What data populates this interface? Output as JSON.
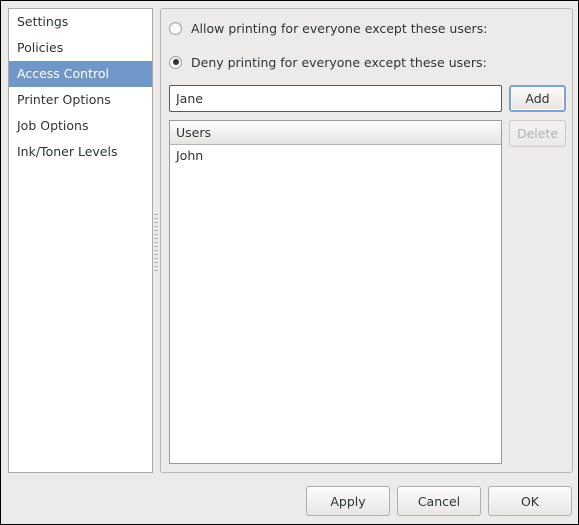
{
  "sidebar": {
    "items": [
      {
        "label": "Settings",
        "selected": false
      },
      {
        "label": "Policies",
        "selected": false
      },
      {
        "label": "Access Control",
        "selected": true
      },
      {
        "label": "Printer Options",
        "selected": false
      },
      {
        "label": "Job Options",
        "selected": false
      },
      {
        "label": "Ink/Toner Levels",
        "selected": false
      }
    ]
  },
  "access_control": {
    "allow_option_label": "Allow printing for everyone except these users:",
    "deny_option_label": "Deny printing for everyone except these users:",
    "allow_selected": false,
    "deny_selected": true,
    "user_entry": {
      "value": "Jane",
      "placeholder": ""
    },
    "add_label": "Add",
    "delete_label": "Delete",
    "delete_disabled": true,
    "list": {
      "header": "Users",
      "rows": [
        "John"
      ]
    }
  },
  "dialog_buttons": {
    "apply": "Apply",
    "cancel": "Cancel",
    "ok": "OK"
  },
  "colors": {
    "selection": "#7196c8",
    "focus_ring": "#7ba2d0",
    "window_bg": "#edebe9",
    "field_bg": "#ffffff",
    "text": "#2e3436",
    "disabled_text": "#b2b0ae"
  }
}
